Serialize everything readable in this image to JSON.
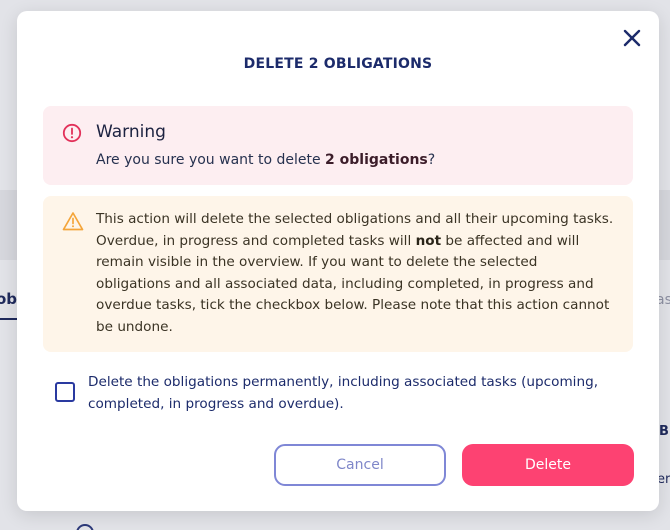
{
  "background": {
    "tab_left_fragment": "obl",
    "tab_right_fragment": "as",
    "text_b_fragment": "B",
    "text_er_fragment": "er"
  },
  "modal": {
    "title": "DELETE 2 OBLIGATIONS",
    "close_icon": "close-x-icon",
    "warning": {
      "icon": "exclamation-circle-icon",
      "title": "Warning",
      "question_prefix": "Are you sure you want to delete ",
      "question_bold": "2 obligations",
      "question_suffix": "?"
    },
    "caution": {
      "icon": "warning-triangle-icon",
      "text_part1": "This action will delete the selected obligations and all their upcoming tasks. Overdue, in progress and completed tasks will ",
      "text_bold": "not",
      "text_part2": " be affected and will remain visible in the overview. If you want to delete the selected obligations and all associated data, including completed, in progress and overdue tasks, tick the checkbox below. Please note that this action cannot be undone."
    },
    "checkbox": {
      "checked": false,
      "label": "Delete the obligations permanently, including associated tasks (upcoming, completed, in progress and overdue)."
    },
    "buttons": {
      "cancel_label": "Cancel",
      "delete_label": "Delete"
    }
  },
  "colors": {
    "title": "#1c2b6b",
    "warning_bg": "#fdeef1",
    "warning_icon": "#e2315a",
    "caution_bg": "#fef5e9",
    "caution_icon": "#f4a53a",
    "cancel_border": "#7f87d6",
    "delete_bg": "#fd4272"
  }
}
